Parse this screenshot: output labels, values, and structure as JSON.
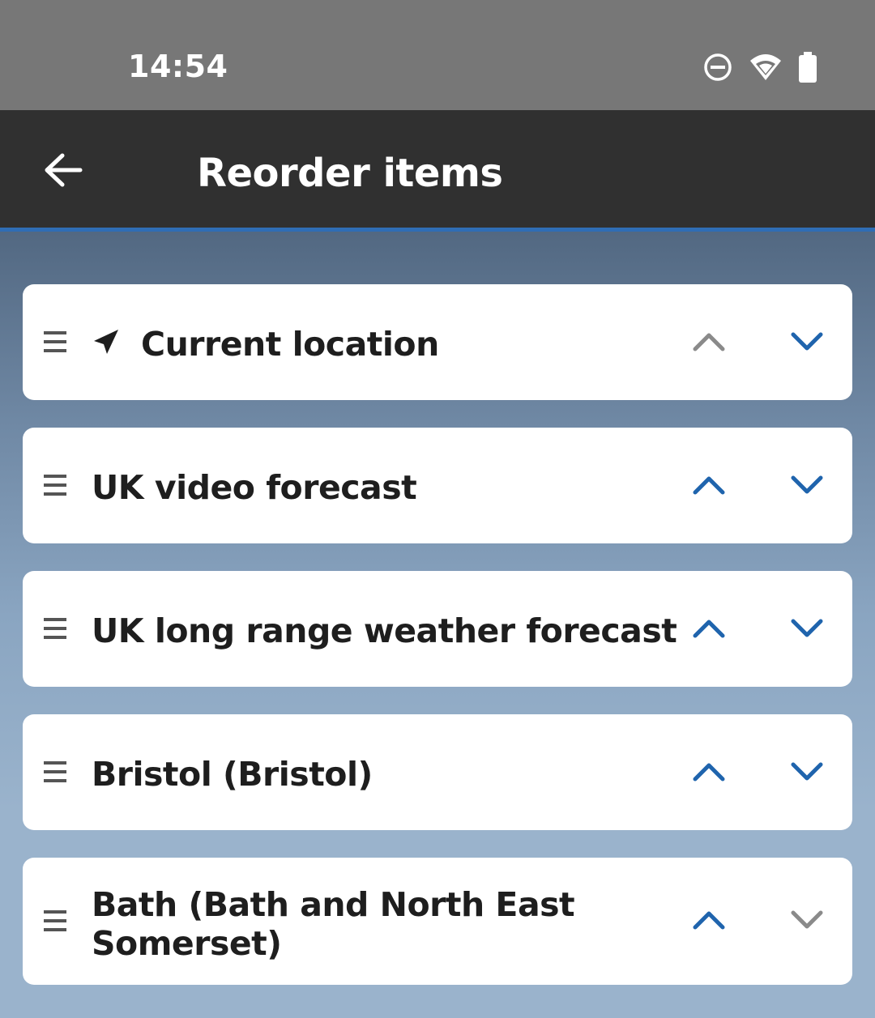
{
  "status_bar": {
    "time": "14:54",
    "icons": [
      "do-not-disturb-icon",
      "wifi-icon",
      "battery-icon"
    ]
  },
  "app_bar": {
    "back_icon": "arrow-left-icon",
    "title": "Reorder items"
  },
  "colors": {
    "accent": "#2f6db5",
    "arrow_enabled": "#1f64ad",
    "arrow_disabled": "#8a8a8a",
    "app_bar_bg": "#303030",
    "status_bar_bg": "#777777"
  },
  "items": [
    {
      "label": "Current location",
      "icon": "navigation-arrow-icon",
      "up_enabled": false,
      "down_enabled": true
    },
    {
      "label": "UK video forecast",
      "up_enabled": true,
      "down_enabled": true
    },
    {
      "label": "UK long range weather forecast",
      "up_enabled": true,
      "down_enabled": true
    },
    {
      "label": "Bristol (Bristol)",
      "up_enabled": true,
      "down_enabled": true
    },
    {
      "label": "Bath (Bath and North East Somerset)",
      "up_enabled": true,
      "down_enabled": false
    }
  ]
}
